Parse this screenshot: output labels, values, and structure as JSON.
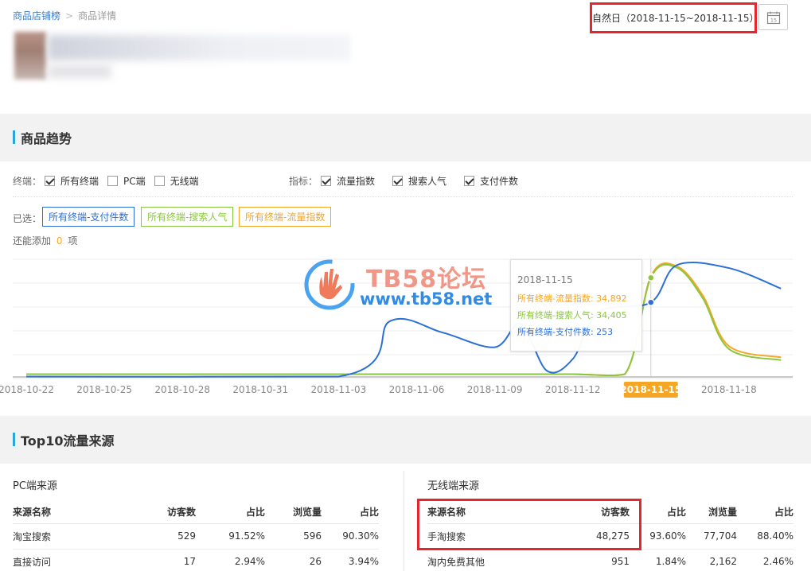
{
  "breadcrumb": {
    "root": "商品店铺榜",
    "sep": ">",
    "current": "商品详情"
  },
  "date_range": "自然日（2018-11-15~2018-11-15）",
  "calendar_day": "15",
  "trend": {
    "title": "商品趋势",
    "terminal_label": "终端：",
    "terminals": [
      {
        "label": "所有终端",
        "checked": true
      },
      {
        "label": "PC端",
        "checked": false
      },
      {
        "label": "无线端",
        "checked": false
      }
    ],
    "metric_label": "指标：",
    "metrics": [
      {
        "label": "流量指数",
        "checked": true
      },
      {
        "label": "搜索人气",
        "checked": true
      },
      {
        "label": "支付件数",
        "checked": true
      }
    ],
    "selected_label": "已选：",
    "selected_tags": [
      {
        "label": "所有终端-支付件数",
        "color": "#2c6fd6"
      },
      {
        "label": "所有终端-搜索人气",
        "color": "#8cc63f"
      },
      {
        "label": "所有终端-流量指数",
        "color": "#f5a623"
      }
    ],
    "add_more_prefix": "还能添加",
    "add_more_count": "0",
    "add_more_suffix": "项"
  },
  "chart_data": {
    "type": "line",
    "x_ticks": [
      "2018-10-22",
      "2018-10-25",
      "2018-10-28",
      "2018-10-31",
      "2018-11-03",
      "2018-11-06",
      "2018-11-09",
      "2018-11-12",
      "2018-11-15",
      "2018-11-18"
    ],
    "highlighted_tick": "2018-11-15",
    "grid": true,
    "series": [
      {
        "name": "所有终端-流量指数",
        "color": "#f5a623",
        "points": [
          [
            "2018-10-22",
            0
          ],
          [
            "2018-10-31",
            0
          ],
          [
            "2018-11-03",
            0
          ],
          [
            "2018-11-05",
            2
          ],
          [
            "2018-11-09",
            2
          ],
          [
            "2018-11-10",
            3
          ],
          [
            "2018-11-12",
            3
          ],
          [
            "2018-11-14",
            4
          ],
          [
            "2018-11-15",
            34892
          ],
          [
            "2018-11-16",
            38500
          ],
          [
            "2018-11-17",
            28000
          ],
          [
            "2018-11-18",
            10000
          ],
          [
            "2018-11-20",
            6000
          ]
        ]
      },
      {
        "name": "所有终端-搜索人气",
        "color": "#8cc63f",
        "points": [
          [
            "2018-10-22",
            0
          ],
          [
            "2018-10-31",
            0
          ],
          [
            "2018-11-03",
            0
          ],
          [
            "2018-11-05",
            2
          ],
          [
            "2018-11-09",
            2
          ],
          [
            "2018-11-10",
            3
          ],
          [
            "2018-11-12",
            3
          ],
          [
            "2018-11-14",
            4
          ],
          [
            "2018-11-15",
            34405
          ],
          [
            "2018-11-16",
            38000
          ],
          [
            "2018-11-17",
            27000
          ],
          [
            "2018-11-18",
            9000
          ],
          [
            "2018-11-20",
            5000
          ]
        ]
      },
      {
        "name": "所有终端-支付件数",
        "color": "#2c6fd6",
        "points": [
          [
            "2018-10-22",
            0
          ],
          [
            "2018-11-03",
            0
          ],
          [
            "2018-11-05",
            190
          ],
          [
            "2018-11-07",
            150
          ],
          [
            "2018-11-09",
            100
          ],
          [
            "2018-11-10",
            180
          ],
          [
            "2018-11-11",
            20
          ],
          [
            "2018-11-12",
            60
          ],
          [
            "2018-11-13",
            220
          ],
          [
            "2018-11-15",
            253
          ],
          [
            "2018-11-16",
            380
          ],
          [
            "2018-11-18",
            370
          ],
          [
            "2018-11-20",
            300
          ]
        ]
      }
    ],
    "tooltip": {
      "date": "2018-11-15",
      "rows": [
        {
          "label": "所有终端-流量指数",
          "value": "34,892",
          "color": "#f5a623"
        },
        {
          "label": "所有终端-搜索人气",
          "value": "34,405",
          "color": "#8cc63f"
        },
        {
          "label": "所有终端-支付件数",
          "value": "253",
          "color": "#2c6fd6"
        }
      ]
    }
  },
  "watermark": {
    "title": "TB58论坛",
    "url": "www.tb58.net"
  },
  "top10": {
    "title": "Top10流量来源",
    "pc": {
      "title": "PC端来源",
      "headers": [
        "来源名称",
        "访客数",
        "占比",
        "浏览量",
        "占比"
      ],
      "rows": [
        [
          "淘宝搜索",
          "529",
          "91.52%",
          "596",
          "90.30%"
        ],
        [
          "直接访问",
          "17",
          "2.94%",
          "26",
          "3.94%"
        ]
      ]
    },
    "mobile": {
      "title": "无线端来源",
      "headers": [
        "来源名称",
        "访客数",
        "占比",
        "浏览量",
        "占比"
      ],
      "rows": [
        [
          "手淘搜索",
          "48,275",
          "93.60%",
          "77,704",
          "88.40%"
        ],
        [
          "淘内免费其他",
          "951",
          "1.84%",
          "2,162",
          "2.46%"
        ]
      ]
    }
  }
}
